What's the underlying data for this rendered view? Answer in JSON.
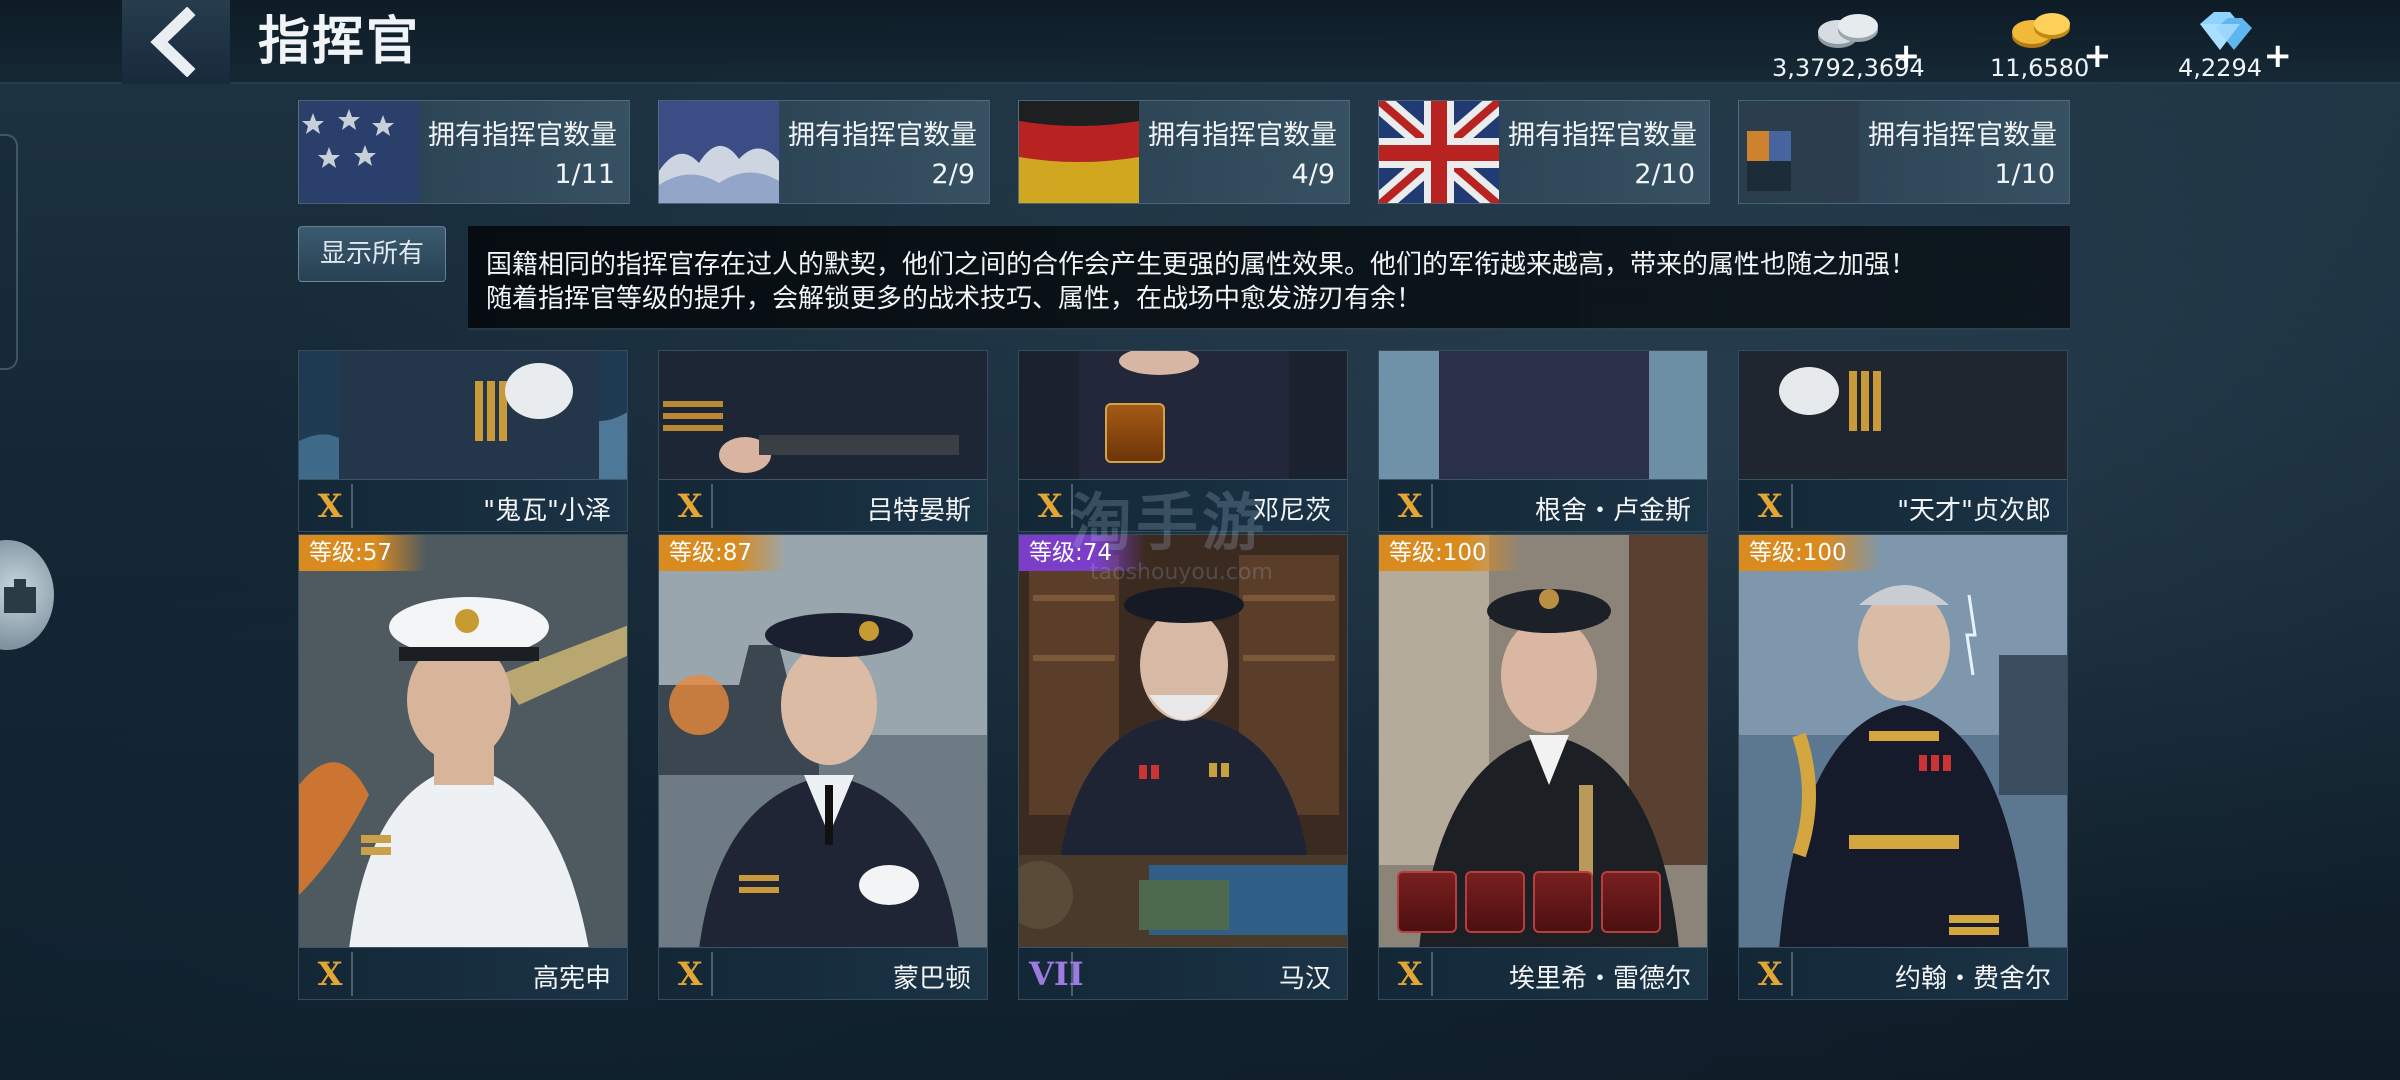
{
  "header": {
    "title": "指挥官",
    "currencies": {
      "silver": "3,3792,3694",
      "gold": "11,6580",
      "gems": "4,2294",
      "plus": "+"
    }
  },
  "nations": [
    {
      "label": "拥有指挥官数量",
      "count": "1/11"
    },
    {
      "label": "拥有指挥官数量",
      "count": "2/9"
    },
    {
      "label": "拥有指挥官数量",
      "count": "4/9"
    },
    {
      "label": "拥有指挥官数量",
      "count": "2/10"
    },
    {
      "label": "拥有指挥官数量",
      "count": "1/10"
    }
  ],
  "show_all_label": "显示所有",
  "info": {
    "line1": "国籍相同的指挥官存在过人的默契，他们之间的合作会产生更强的属性效果。他们的军衔越来越高，带来的属性也随之加强！",
    "line2": "随着指挥官等级的提升，会解锁更多的战术技巧、属性，在战场中愈发游刃有余！"
  },
  "commanders_row1": [
    {
      "rank": "X",
      "name": "\"鬼瓦\"小泽"
    },
    {
      "rank": "X",
      "name": "吕特晏斯"
    },
    {
      "rank": "X",
      "name": "邓尼茨"
    },
    {
      "rank": "X",
      "name": "根舍・卢金斯"
    },
    {
      "rank": "X",
      "name": "\"天才\"贞次郎"
    }
  ],
  "commanders_row2": [
    {
      "rank": "X",
      "name": "高宪申",
      "level": "等级:57"
    },
    {
      "rank": "X",
      "name": "蒙巴顿",
      "level": "等级:87"
    },
    {
      "rank": "VII",
      "name": "马汉",
      "level": "等级:74"
    },
    {
      "rank": "X",
      "name": "埃里希・雷德尔",
      "level": "等级:100"
    },
    {
      "rank": "X",
      "name": "约翰・费舍尔",
      "level": "等级:100"
    }
  ],
  "watermark": {
    "main": "淘手游",
    "sub": "taoshouyou.com"
  },
  "colors": {
    "level_orange": "#d98b1f",
    "level_purple": "#7a3ec8",
    "rank_gold": "#e3a633",
    "rank_purple": "#9e7be0"
  }
}
